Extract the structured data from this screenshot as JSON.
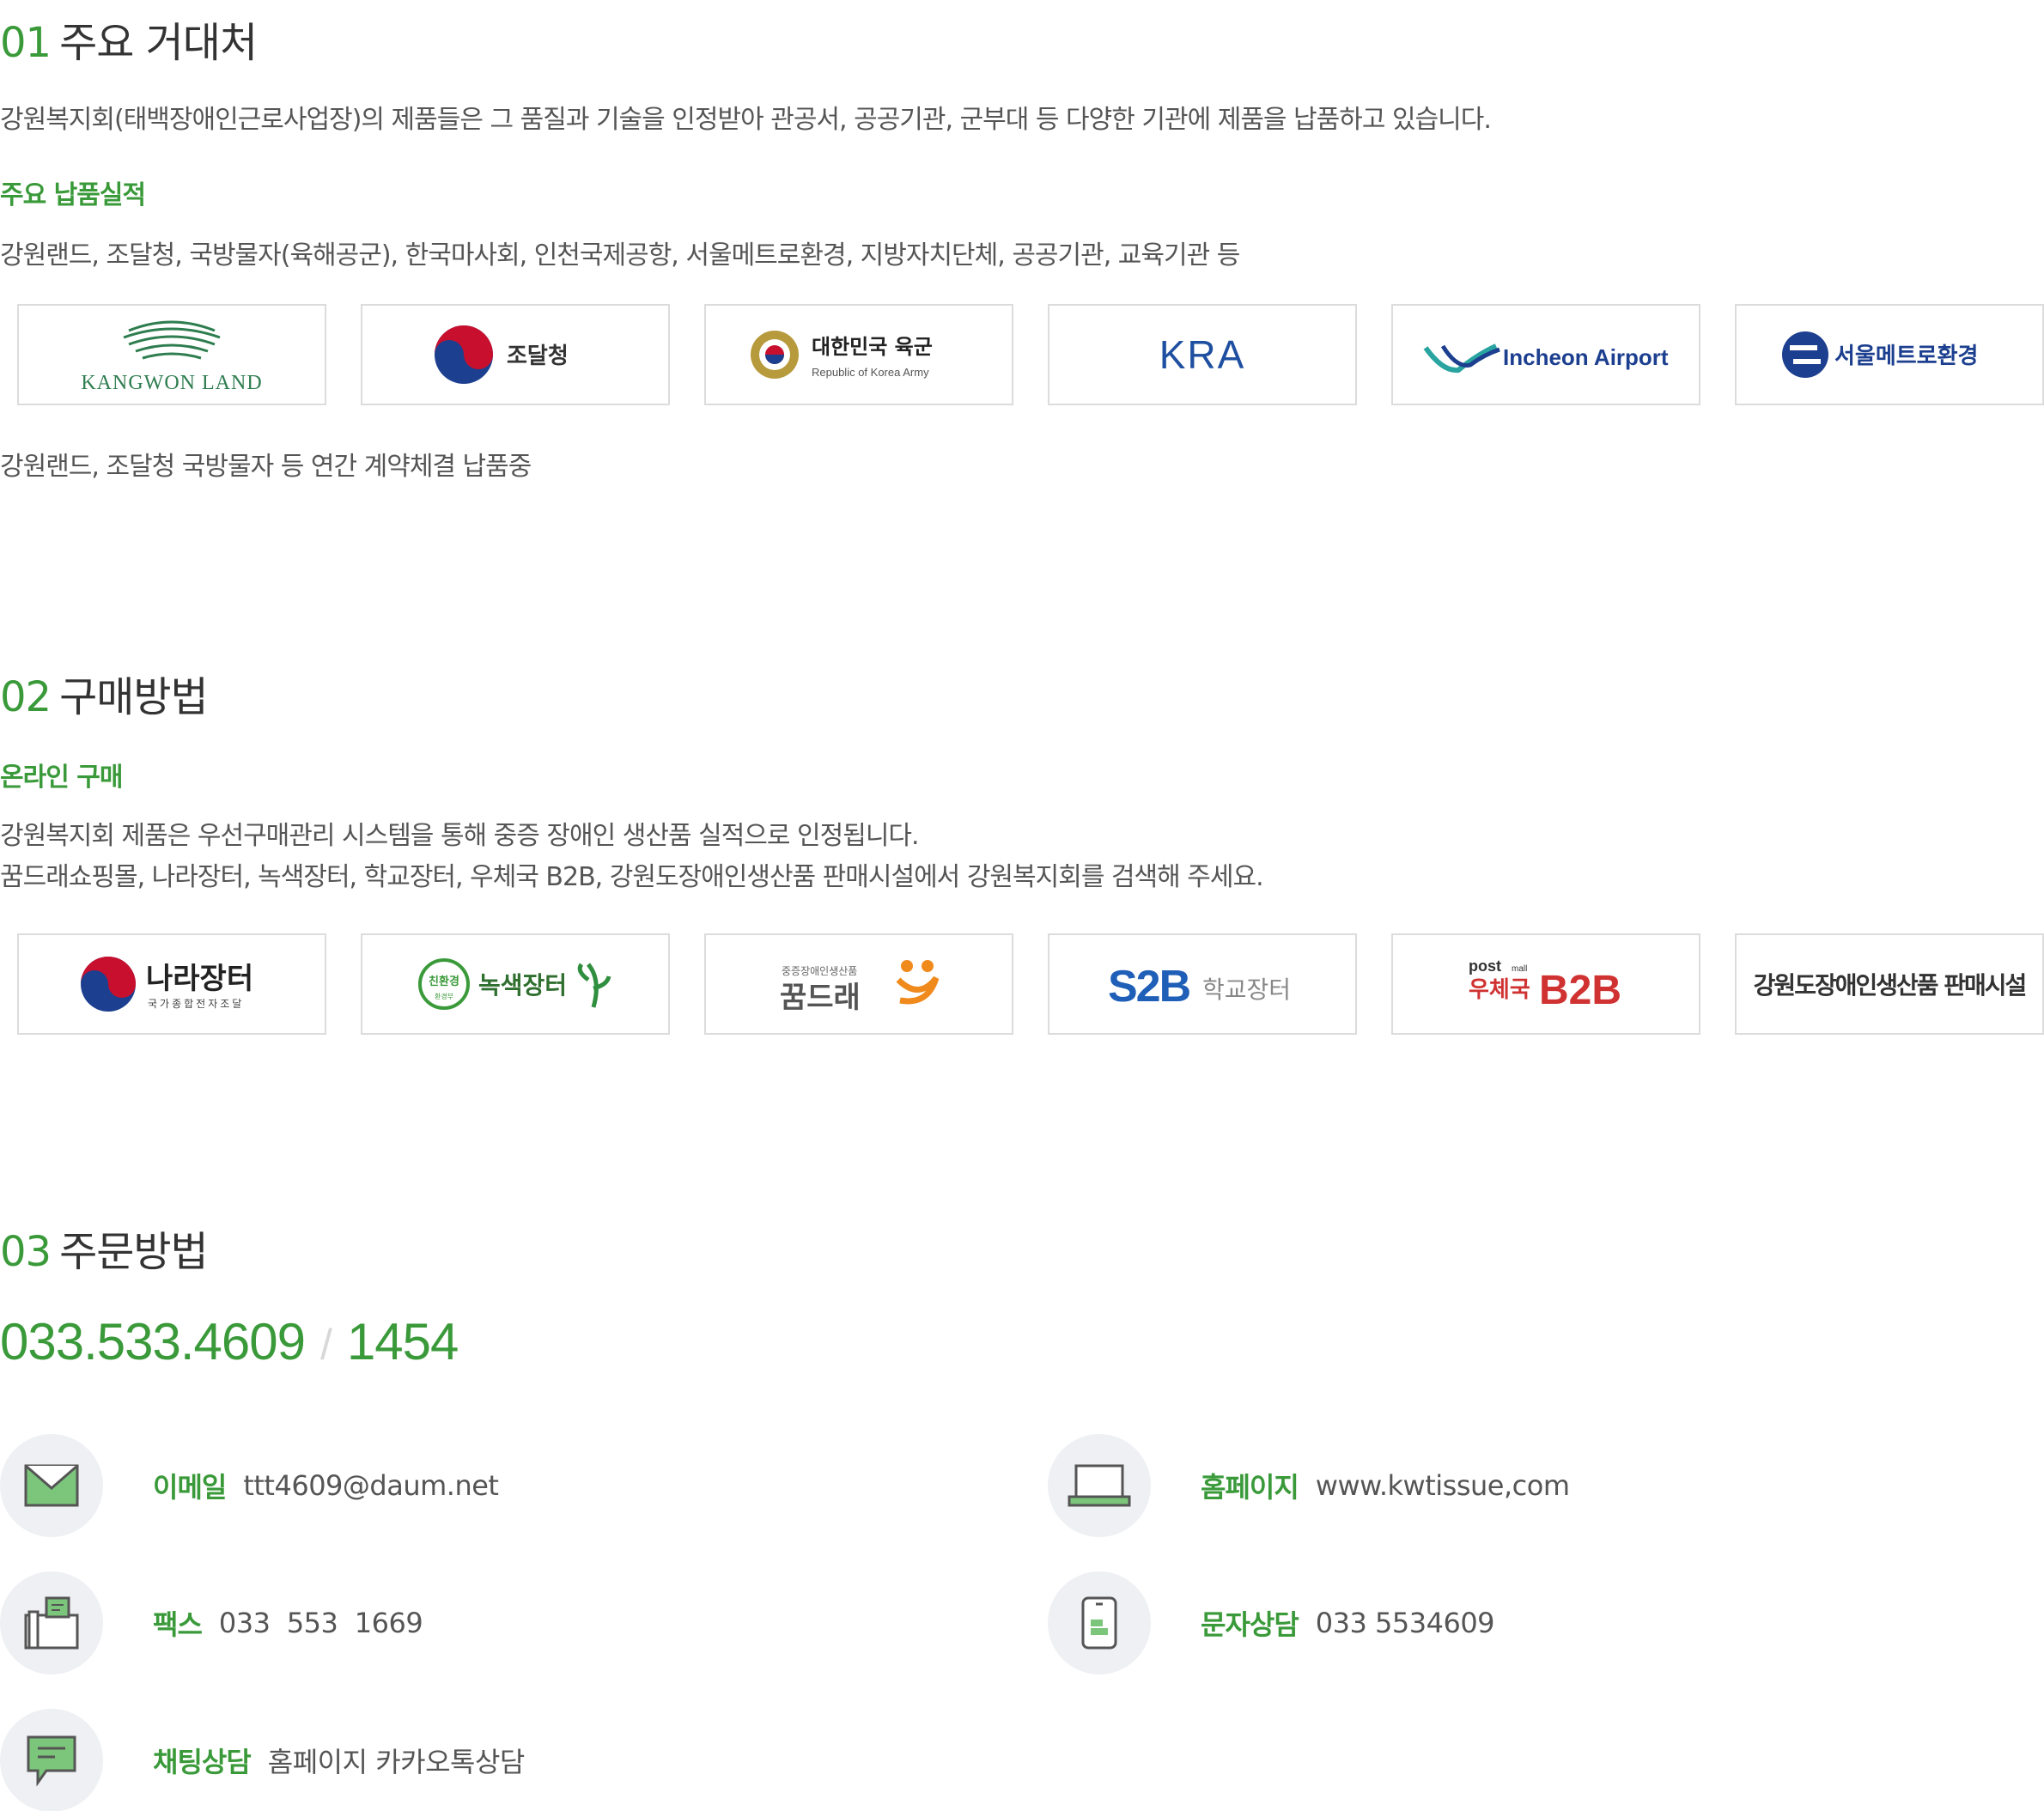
{
  "section1": {
    "num": "01",
    "title": "주요 거대처",
    "intro": "강원복지회(태백장애인근로사업장)의 제품들은 그 품질과 기술을 인정받아 관공서, 공공기관, 군부대 등 다양한 기관에 제품을 납품하고 있습니다.",
    "subhead": "주요 납품실적",
    "list": "강원랜드, 조달청, 국방물자(육해공군), 한국마사회, 인천국제공항, 서울메트로환경, 지방자치단체, 공공기관, 교육기관 등",
    "logos": {
      "kangwon": "KANGWON LAND",
      "pps": "조달청",
      "army_ko": "대한민국 육군",
      "army_en": "Republic of Korea Army",
      "kra": "KRA",
      "incheon": "Incheon Airport",
      "metro": "서울메트로환경"
    },
    "note": "강원랜드, 조달청 국방물자 등 연간 계약체결 납품중"
  },
  "section2": {
    "num": "02",
    "title": "구매방법",
    "subhead": "온라인 구매",
    "line1": "강원복지회 제품은 우선구매관리 시스템을 통해 중증 장애인 생산품 실적으로 인정됩니다.",
    "line2": "꿈드래쇼핑몰, 나라장터, 녹색장터, 학교장터, 우체국 B2B, 강원도장애인생산품 판매시설에서 강원복지회를 검색해 주세요.",
    "logos": {
      "nara": "나라장터",
      "nara_sub": "국가종합전자조달",
      "green_badge": "친환경",
      "green_badge_sub": "환경부",
      "green": "녹색장터",
      "kkum_sub": "중증장애인생산품",
      "kkum": "꿈드래",
      "s2b": "S2B",
      "s2b_sub": "학교장터",
      "post": "post",
      "post_mall": "mall",
      "post_ko": "우체국",
      "b2b": "B2B",
      "gangwon": "강원도장애인생산품 판매시설"
    }
  },
  "section3": {
    "num": "03",
    "title": "주문방법",
    "phone1": "033.533.4609",
    "phone_sep": "/",
    "phone2": "1454",
    "contacts": {
      "email": {
        "label": "이메일",
        "value": "ttt4609@daum.net"
      },
      "homepage": {
        "label": "홈페이지",
        "value": "www.kwtissue,com"
      },
      "fax": {
        "label": "팩스",
        "value": "033  553  1669"
      },
      "sms": {
        "label": "문자상담",
        "value": "033 5534609"
      },
      "chat": {
        "label": "채팅상담",
        "value": "홈페이지 카카오톡상담"
      }
    }
  },
  "colors": {
    "accent": "#3a9a3a",
    "text": "#555555",
    "border": "#dcdcdc",
    "icon_bg": "#eef0f3"
  }
}
